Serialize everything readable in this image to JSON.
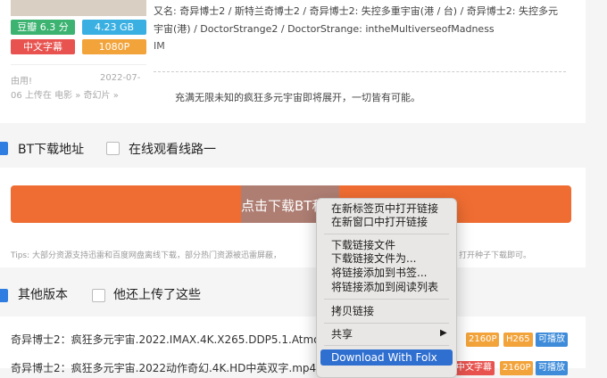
{
  "movie": {
    "badges": {
      "douban": "豆瓣 6.3 分",
      "size": "4.23 GB",
      "subtitle": "中文字幕",
      "resolution": "1080P"
    },
    "aka_line1": "又名: 奇异博士2 / 斯特兰奇博士2 / 奇异博士2: 失控多重宇宙(港 / 台) / 奇异博士2: 失控多元",
    "aka_line2": "宇宙(港) / DoctorStrange2 / DoctorStrange: intheMultiverseofMadness",
    "imdb_fragment": "IM",
    "uploader": "由用!",
    "upload_date": "2022-07-",
    "upload_line": "06 上传在 电影 » 奇幻片 »",
    "description": "充满无限未知的疯狂多元宇宙即将展开，一切皆有可能。"
  },
  "tabs": {
    "bt": "BT下载地址",
    "online": "在线观看线路一"
  },
  "download": {
    "button_label": "点击下载BT种",
    "tips": "Tips: 大部分资源支持迅雷和百度网盘离线下载，部分热门资源被迅雷屏蔽，",
    "tips_tail": "打开种子下载即可。"
  },
  "versions": {
    "title": "其他版本",
    "uploader_title": "他还上传了这些"
  },
  "resources": [
    {
      "title": "奇异博士2：疯狂多元宇宙.2022.IMAX.4K.X265.DDP5.1.Atmos.En",
      "tags": [
        "2160P",
        "H265",
        "可播放"
      ]
    },
    {
      "title": "奇异博士2：疯狂多元宇宙.2022动作奇幻.4K.HD中英双字.mp4.tor",
      "tags": [
        "中文字幕",
        "2160P",
        "可播放"
      ]
    }
  ],
  "context_menu": {
    "items": [
      "在新标签页中打开链接",
      "在新窗口中打开链接",
      "下载链接文件",
      "下载链接文件为...",
      "将链接添加到书签...",
      "将链接添加到阅读列表",
      "拷贝链接",
      "共享",
      "Download With Folx"
    ]
  },
  "colors": {
    "douban": "#3cb371",
    "size": "#3ab0e2",
    "subtitle": "#e8534f",
    "resolution": "#f2a33a",
    "button": "#ef6d32",
    "highlight": "#2f6fd0",
    "play": "#3d8bd9"
  }
}
